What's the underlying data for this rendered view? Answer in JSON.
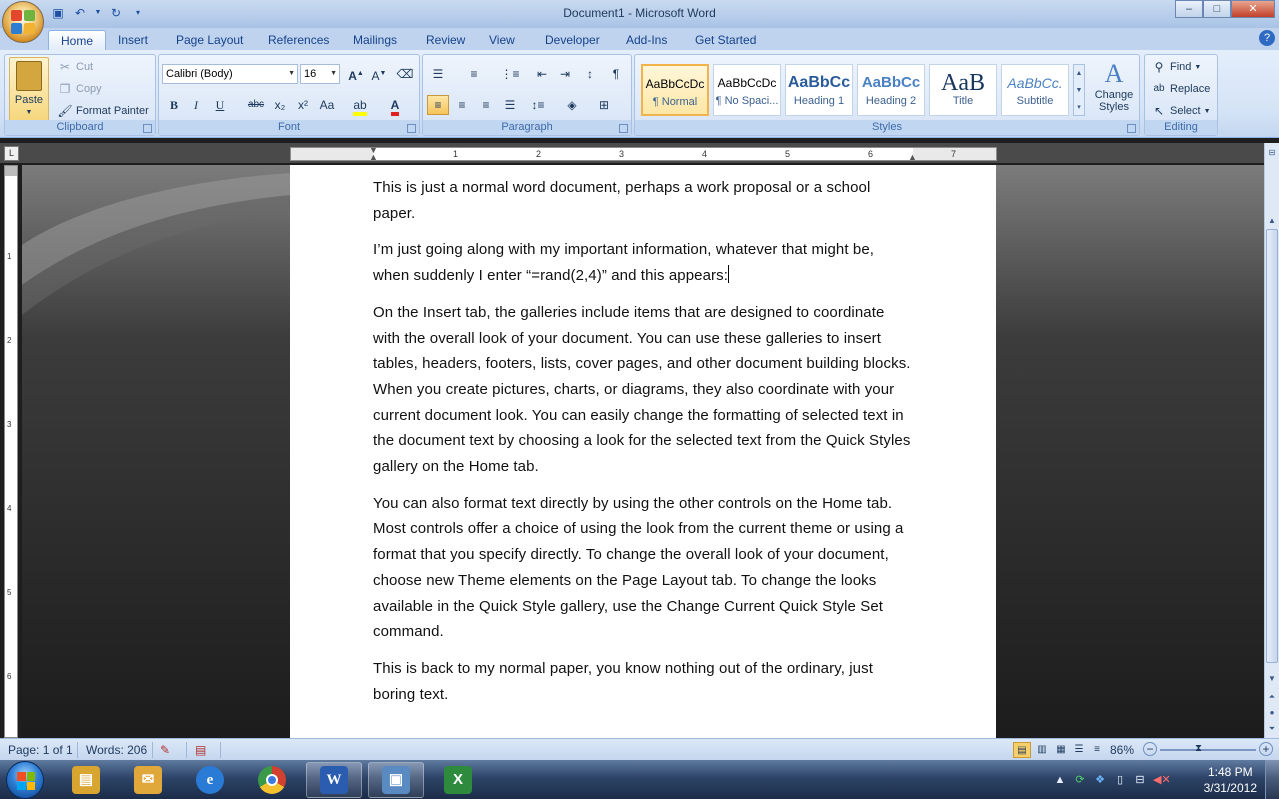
{
  "window": {
    "title": "Document1 - Microsoft Word",
    "minimize": "–",
    "maximize": "□",
    "close": "✕"
  },
  "tabs": [
    "Home",
    "Insert",
    "Page Layout",
    "References",
    "Mailings",
    "Review",
    "View",
    "Developer",
    "Add-Ins",
    "Get Started"
  ],
  "ribbon": {
    "clipboard": {
      "label": "Clipboard",
      "paste": "Paste",
      "cut": "Cut",
      "copy": "Copy",
      "format_painter": "Format Painter"
    },
    "font": {
      "label": "Font",
      "font_name": "Calibri (Body)",
      "font_size": "16",
      "bold": "B",
      "italic": "I",
      "underline": "U",
      "strike": "abc",
      "subscript": "x₂",
      "superscript": "x²",
      "change_case": "Aa"
    },
    "paragraph": {
      "label": "Paragraph",
      "show_marks": "¶"
    },
    "styles": {
      "label": "Styles",
      "items": [
        {
          "sample": "AaBbCcDc",
          "name": "¶ Normal"
        },
        {
          "sample": "AaBbCcDc",
          "name": "¶ No Spaci..."
        },
        {
          "sample": "AaBbCc",
          "name": "Heading 1"
        },
        {
          "sample": "AaBbCc",
          "name": "Heading 2"
        },
        {
          "sample": "AaB",
          "name": "Title"
        },
        {
          "sample": "AaBbCc.",
          "name": "Subtitle"
        }
      ],
      "change_styles": "Change Styles"
    },
    "editing": {
      "label": "Editing",
      "find": "Find",
      "replace": "Replace",
      "select": "Select"
    }
  },
  "ruler": {
    "numbers": [
      "1",
      "2",
      "3",
      "4",
      "5",
      "6",
      "7"
    ]
  },
  "vruler": {
    "numbers": [
      "1",
      "2",
      "3",
      "4",
      "5",
      "6"
    ]
  },
  "document": {
    "paragraphs": [
      "This is just a normal word document, perhaps a work proposal or a school paper.",
      "I’m just going along with my important information, whatever that might be, when suddenly I enter “=rand(2,4)” and this appears:",
      "On the Insert tab, the galleries include items that are designed to coordinate with the overall look of your document. You can use these galleries to insert tables, headers, footers, lists, cover pages, and other document building blocks. When you create pictures, charts, or diagrams, they also coordinate with your current document look. You can easily change the formatting of selected text in the document text by choosing a look for the selected text from the Quick Styles gallery on the Home tab.",
      "You can also format text directly by using the other controls on the Home tab. Most controls offer a choice of using the look from the current theme or using a format that you specify directly. To change the overall look of your document, choose new Theme elements on the Page Layout tab. To change the looks available in the Quick Style gallery, use the Change Current Quick Style Set command.",
      "This is back to my normal paper, you know nothing out of the ordinary, just boring text."
    ]
  },
  "statusbar": {
    "page": "Page: 1 of 1",
    "words": "Words: 206",
    "zoom": "86%"
  },
  "taskbar": {
    "time": "1:48 PM",
    "date": "3/31/2012",
    "apps": [
      {
        "name": "explorer",
        "glyph": "▤",
        "color": "#d9a531"
      },
      {
        "name": "outlook-express",
        "glyph": "✉",
        "color": "#e0a83a"
      },
      {
        "name": "internet-explorer",
        "glyph": "e",
        "color": "#2a7bd6"
      },
      {
        "name": "chrome",
        "glyph": "◉",
        "color": "#d0412f"
      },
      {
        "name": "word",
        "glyph": "W",
        "color": "#2a5db0"
      },
      {
        "name": "remote-desktop",
        "glyph": "▣",
        "color": "#5a8ac2"
      },
      {
        "name": "excel",
        "glyph": "X",
        "color": "#2e8b3e"
      }
    ]
  }
}
